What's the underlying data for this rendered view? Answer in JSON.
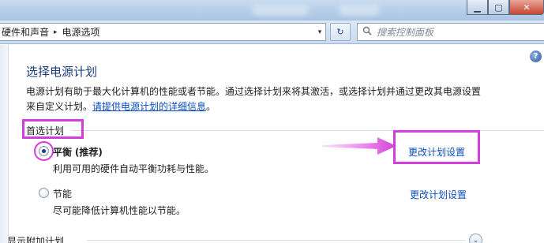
{
  "window": {
    "minimize_icon": "minimize-icon",
    "maximize_icon": "maximize-icon",
    "close_icon": "close-icon",
    "minimize_glyph": "▁",
    "maximize_glyph": "▢",
    "close_glyph": "✕"
  },
  "address": {
    "crumbs": [
      "硬件和声音",
      "电源选项"
    ],
    "separator": "▸",
    "dropdown": "▾",
    "refresh": "↻",
    "search_placeholder": "搜索控制面板",
    "search_icon": "search-icon"
  },
  "help": {
    "label": "?"
  },
  "page": {
    "title": "选择电源计划",
    "desc_line1": "电源计划有助于最大化计算机的性能或者节能。通过选择计划来将其激活，或选择计划并通过更改其电源设置",
    "desc_line2_prefix": "来自定义计划。",
    "desc_link": "请提供电源计划的详细信息",
    "desc_line2_suffix": "。"
  },
  "preferred": {
    "header": "首选计划",
    "plans": [
      {
        "name": "平衡",
        "tag": "(推荐)",
        "description": "利用可用的硬件自动平衡功耗与性能。",
        "link": "更改计划设置",
        "selected": true
      },
      {
        "name": "节能",
        "tag": "",
        "description": "尽可能降低计算机性能以节能。",
        "link": "更改计划设置",
        "selected": false
      }
    ]
  },
  "additional": {
    "header": "显示附加计划",
    "expand_icon": "chevron-down-icon",
    "expand_glyph": "⌄"
  },
  "colors": {
    "highlight": "#d33fdc",
    "link": "#0a4fbd",
    "title": "#1a3d7a"
  }
}
